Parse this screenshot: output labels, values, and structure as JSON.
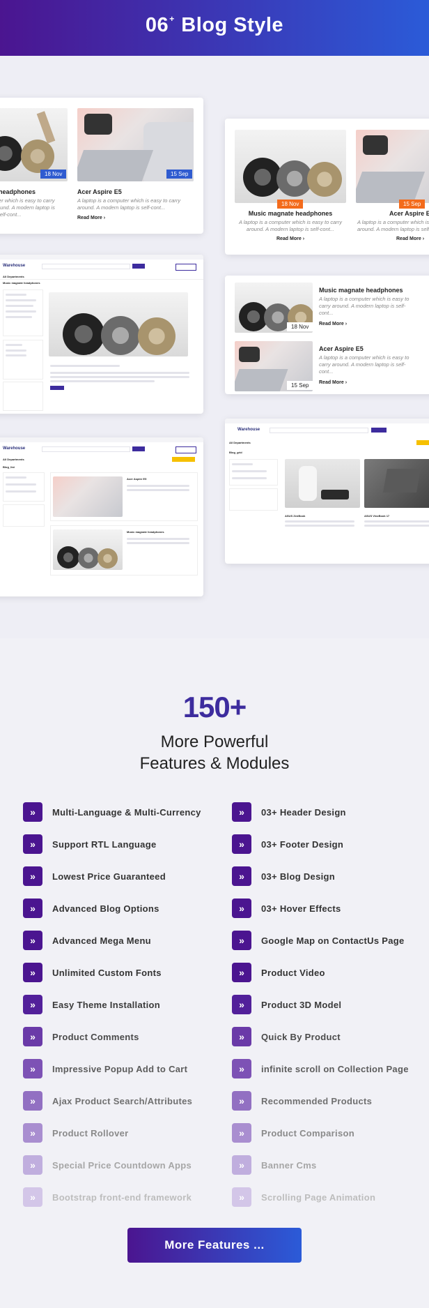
{
  "header": {
    "title_num": "06",
    "title_sup": "+",
    "title_text": "Blog Style"
  },
  "showcase": {
    "card1": {
      "left": {
        "title": "headphones",
        "desc": "ter which is easy to carry ound. A modern laptop is self-cont...",
        "date": "18 Nov"
      },
      "right": {
        "title": "Acer Aspire E5",
        "desc": "A laptop is a computer which is easy to carry around. A modern laptop is self-cont...",
        "date": "15 Sep",
        "read_more": "Read More ›"
      }
    },
    "card2": {
      "left": {
        "title": "Music magnate headphones",
        "desc": "A laptop is a computer which is easy to carry around. A modern laptop is self-cont...",
        "date": "18 Nov",
        "read_more": "Read More ›"
      },
      "right": {
        "title": "Acer Aspire E",
        "desc": "A laptop is a computer which is easy to carry around. A modern laptop is self-cont...",
        "date": "15 Sep",
        "read_more": "Read More ›"
      }
    },
    "card3": {
      "items": [
        {
          "title": "Music magnate headphones",
          "desc": "A laptop is a computer which is easy to carry around. A modern laptop is self-cont...",
          "date": "18 Nov",
          "read_more": "Read More ›"
        },
        {
          "title": "Acer Aspire E5",
          "desc": "A laptop is a computer which is easy to carry around. A modern laptop is self-cont...",
          "date": "15 Sep",
          "read_more": "Read More ›"
        }
      ]
    },
    "screens": {
      "logo": "Warehouse",
      "all_departments": "All Departments",
      "blog_detail_title": "Music magnate headphones",
      "blog_grid_title": "Blog_grid",
      "blog_list_title": "Blog_list",
      "post_a": "Acer Aspire E5",
      "post_b": "Music magnate headphones",
      "post_c": "ASUS ZenBook",
      "post_d": "ASUS VivoBook 17",
      "recent_articles": "Recent Articles",
      "categories": "Categories",
      "search": "Search",
      "my_cart": "My Cart",
      "read_more": "Read More"
    }
  },
  "features": {
    "count": "150+",
    "subtitle_line1": "More Powerful",
    "subtitle_line2": "Features & Modules",
    "left": [
      "Multi-Language & Multi-Currency",
      "Support RTL Language",
      "Lowest Price Guaranteed",
      "Advanced Blog Options",
      "Advanced Mega Menu",
      "Unlimited Custom Fonts",
      "Easy Theme Installation",
      "Product Comments",
      "Impressive Popup Add to Cart",
      "Ajax Product Search/Attributes",
      "Product Rollover",
      "Special Price Countdown Apps",
      "Bootstrap front-end framework"
    ],
    "right": [
      "03+ Header Design",
      "03+ Footer Design",
      "03+ Blog Design",
      "03+ Hover Effects",
      "Google Map on ContactUs Page",
      "Product Video",
      "Product 3D Model",
      "Quick By Product",
      "infinite scroll on Collection Page",
      "Recommended Products",
      "Product Comparison",
      "Banner Cms",
      "Scrolling Page Animation"
    ],
    "icon": "double-chevron-right-icon",
    "icon_glyph": "»",
    "more_button": "More Features ..."
  },
  "colors": {
    "brand_purple": "#4b1590",
    "brand_blue": "#2b5bd8",
    "badge_blue": "#2f5bd0",
    "badge_orange": "#f36b1c"
  }
}
